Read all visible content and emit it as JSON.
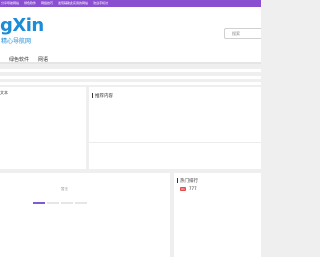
{
  "topbar": {
    "items": [
      "分享导航网站",
      "绿色软件",
      "网络技巧",
      "发现辅助此实用的网站",
      "欢迎手机访"
    ]
  },
  "header": {
    "logo_text": "gXin",
    "logo_sub": "精心导航网",
    "search_placeholder": "搜索"
  },
  "nav": {
    "items": [
      "绿色软件",
      "网语"
    ]
  },
  "panels": {
    "left_title": "文本",
    "right_title": "推荐内容",
    "bottom_label": "暂无",
    "hot_title": "热门排行",
    "hot_items": [
      {
        "rank": "01",
        "text": "777"
      }
    ]
  },
  "colors": {
    "accent": "#8a4fd1",
    "logo": "#1a8cd8"
  }
}
